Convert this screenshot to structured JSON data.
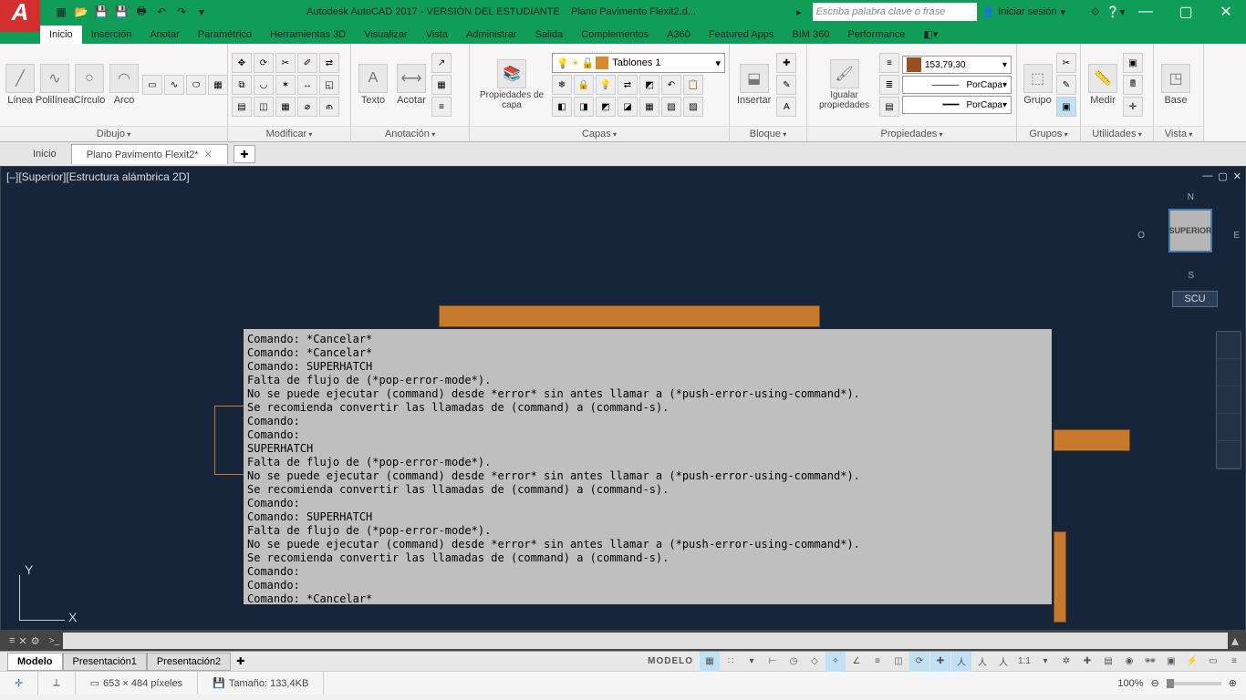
{
  "title": {
    "app": "Autodesk AutoCAD 2017 - VERSIÓN DEL ESTUDIANTE",
    "file": "Plano Pavimento Flexit2.d..."
  },
  "search_placeholder": "Escriba palabra clave o frase",
  "sign_in": "Iniciar sesión",
  "ribbon_tabs": [
    "Inicio",
    "Inserción",
    "Anotar",
    "Paramétrico",
    "Herramientas 3D",
    "Visualizar",
    "Vista",
    "Administrar",
    "Salida",
    "Complementos",
    "A360",
    "Featured Apps",
    "BIM 360",
    "Performance"
  ],
  "panels": {
    "dibujo": "Dibujo",
    "modificar": "Modificar",
    "anotacion": "Anotación",
    "capas": "Capas",
    "bloque": "Bloque",
    "propiedades": "Propiedades",
    "grupos": "Grupos",
    "utilidades": "Utilidades",
    "vista": "Vista"
  },
  "draw": {
    "linea": "Línea",
    "polilinea": "Polilínea",
    "circulo": "Círculo",
    "arco": "Arco"
  },
  "annot": {
    "texto": "Texto",
    "acotar": "Acotar"
  },
  "layer": {
    "propiedades": "Propiedades de capa",
    "current": "Tablones 1"
  },
  "block": {
    "insertar": "Insertar"
  },
  "props": {
    "igualar": "Igualar propiedades",
    "color": "153,79,30",
    "line": "PorCapa",
    "weight": "PorCapa"
  },
  "groups": {
    "grupo": "Grupo"
  },
  "util": {
    "medir": "Medir",
    "base": "Base"
  },
  "doc_tabs": {
    "home": "Inicio",
    "file": "Plano Pavimento Flexit2*"
  },
  "viewport": {
    "label": "[–][Superior][Estructura alámbrica 2D]",
    "cube": "SUPERIOR",
    "n": "N",
    "s": "S",
    "e": "E",
    "o": "O",
    "scu": "SCU"
  },
  "cmd_history": [
    "Comando: *Cancelar*",
    "Comando: *Cancelar*",
    "Comando: SUPERHATCH",
    "Falta de flujo de (*pop-error-mode*).",
    "No se puede ejecutar (command) desde *error* sin antes llamar a (*push-error-using-command*).",
    "Se recomienda convertir las llamadas de (command) a (command-s).",
    "Comando:",
    "Comando:",
    "SUPERHATCH",
    "Falta de flujo de (*pop-error-mode*).",
    "No se puede ejecutar (command) desde *error* sin antes llamar a (*push-error-using-command*).",
    "Se recomienda convertir las llamadas de (command) a (command-s).",
    "Comando:",
    "Comando: SUPERHATCH",
    "Falta de flujo de (*pop-error-mode*).",
    "No se puede ejecutar (command) desde *error* sin antes llamar a (*push-error-using-command*).",
    "Se recomienda convertir las llamadas de (command) a (command-s).",
    "Comando:",
    "Comando:",
    "Comando: *Cancelar*"
  ],
  "cmdline_prompt": ">_",
  "layouts": {
    "model": "Modelo",
    "p1": "Presentación1",
    "p2": "Presentación2"
  },
  "status": {
    "model": "MODELO",
    "scale": "1:1"
  },
  "bottom": {
    "dims": "653 × 484 píxeles",
    "size": "Tamaño: 133,4KB",
    "zoom": "100%"
  }
}
